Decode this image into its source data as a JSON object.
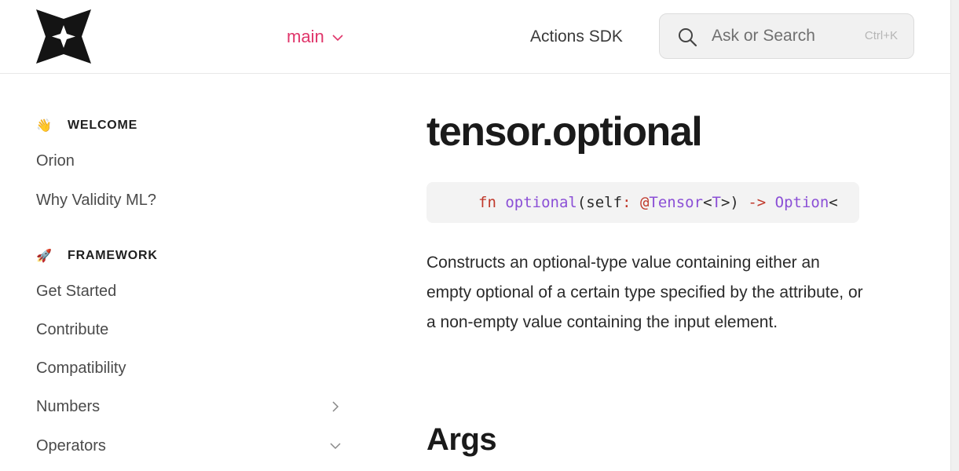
{
  "header": {
    "version_label": "main",
    "sdk_link": "Actions SDK",
    "search": {
      "placeholder": "Ask or Search",
      "shortcut": "Ctrl+K"
    }
  },
  "sidebar": {
    "sections": [
      {
        "title": "WELCOME",
        "emoji": "👋",
        "items": [
          "Orion",
          "Why Validity ML?"
        ]
      },
      {
        "title": "FRAMEWORK",
        "emoji": "🚀",
        "items": [
          "Get Started",
          "Contribute",
          "Compatibility",
          "Numbers",
          "Operators"
        ]
      }
    ]
  },
  "main": {
    "title": "tensor.optional",
    "code": {
      "kw_fn": "fn",
      "name": "optional",
      "open": "(self",
      "colon": ":",
      "at": "@",
      "type": "Tensor",
      "lt": "<",
      "tparam": "T",
      "close": ">)",
      "arrow": "->",
      "ret": "Option",
      "ret_lt": "<"
    },
    "description": "Constructs an optional-type value containing either an empty optional of a certain type specified by the attribute, or a non-empty value containing the input element.",
    "args_title": "Args"
  }
}
